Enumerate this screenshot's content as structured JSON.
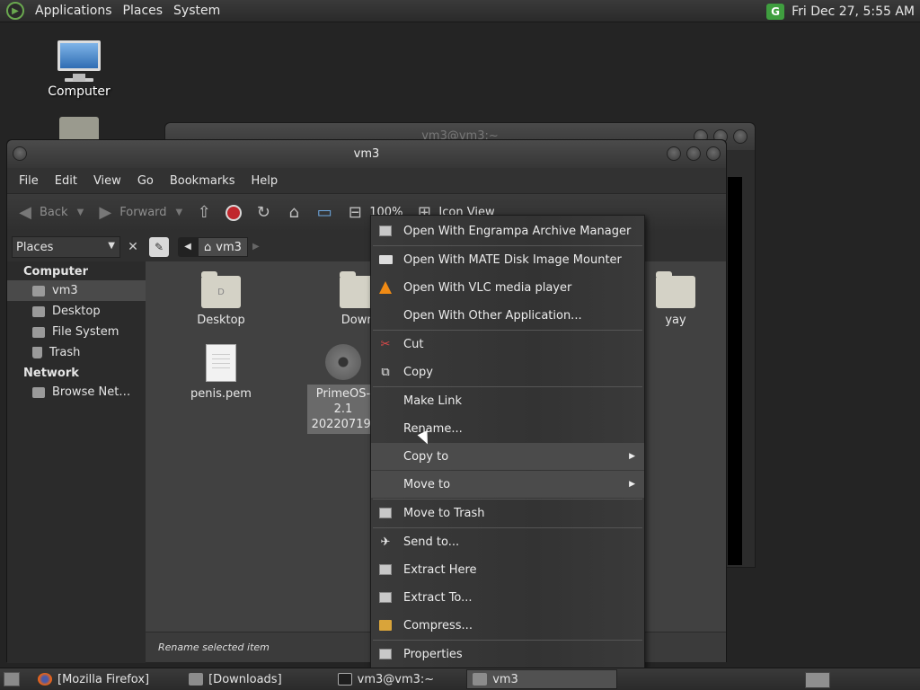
{
  "top_panel": {
    "menus": [
      "Applications",
      "Places",
      "System"
    ],
    "clock": "Fri Dec 27,  5:55 AM"
  },
  "desktop": {
    "icons": [
      {
        "label": "Computer"
      }
    ]
  },
  "back_window": {
    "title": "vm3@vm3:~"
  },
  "window": {
    "title": "vm3",
    "menubar": [
      "File",
      "Edit",
      "View",
      "Go",
      "Bookmarks",
      "Help"
    ],
    "toolbar": {
      "back": "Back",
      "forward": "Forward",
      "zoom": "100%",
      "view_mode": "Icon View"
    },
    "location": {
      "places_label": "Places",
      "crumb": "vm3"
    },
    "sidebar": {
      "computer_header": "Computer",
      "computer_items": [
        "vm3",
        "Desktop",
        "File System",
        "Trash"
      ],
      "network_header": "Network",
      "network_items": [
        "Browse Net…"
      ]
    },
    "files": [
      {
        "name": "Desktop"
      },
      {
        "name": "Downl"
      },
      {
        "name": "yay"
      },
      {
        "name": "penis.pem"
      },
      {
        "name_line1": "PrimeOS-2.1",
        "name_line2": "20220719-"
      }
    ],
    "status": "Rename selected item"
  },
  "context_menu": {
    "items": [
      "Open With Engrampa Archive Manager",
      "Open With MATE Disk Image Mounter",
      "Open With VLC media player",
      "Open With Other Application...",
      "Cut",
      "Copy",
      "Make Link",
      "Rename...",
      "Copy to",
      "Move to",
      "Move to Trash",
      "Send to...",
      "Extract Here",
      "Extract To...",
      "Compress...",
      "Properties"
    ]
  },
  "taskbar": {
    "tasks": [
      "[Mozilla Firefox]",
      "[Downloads]",
      "vm3@vm3:~",
      "vm3"
    ]
  }
}
